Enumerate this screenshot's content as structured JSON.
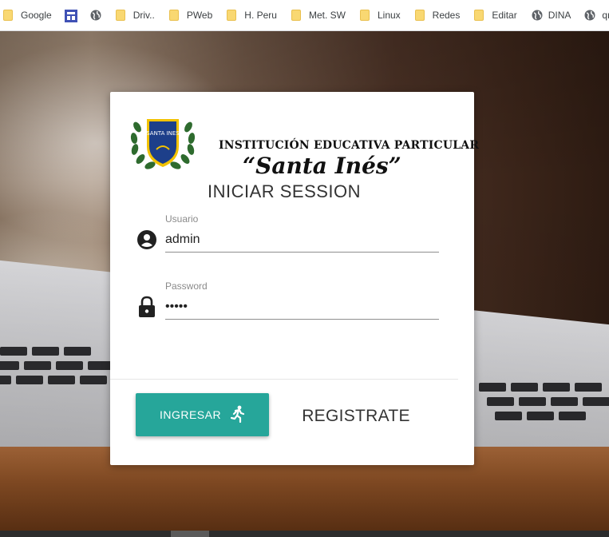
{
  "bookmarks": [
    {
      "label": "Google",
      "icon": "folder-icon"
    },
    {
      "label": "",
      "icon": "app-icon"
    },
    {
      "label": "",
      "icon": "globe-icon"
    },
    {
      "label": "Driv..",
      "icon": "folder-icon"
    },
    {
      "label": "PWeb",
      "icon": "folder-icon"
    },
    {
      "label": "H. Peru",
      "icon": "folder-icon"
    },
    {
      "label": "Met. SW",
      "icon": "folder-icon"
    },
    {
      "label": "Linux",
      "icon": "folder-icon"
    },
    {
      "label": "Redes",
      "icon": "folder-icon"
    },
    {
      "label": "Editar",
      "icon": "folder-icon"
    },
    {
      "label": "DINA",
      "icon": "globe-icon"
    },
    {
      "label": "qno",
      "icon": "globe-icon"
    }
  ],
  "login": {
    "school_line1": "INSTITUCIÓN EDUCATIVA PARTICULAR",
    "school_line2": "“Santa Inés”",
    "logo_text": "SANTA INES",
    "title": "INICIAR SESSION",
    "username_label": "Usuario",
    "username_value": "admin",
    "password_label": "Password",
    "password_value": "•••••",
    "submit_label": "INGRESAR",
    "register_label": "REGISTRATE"
  },
  "colors": {
    "accent": "#26a69a",
    "folder": "#f9d872"
  }
}
